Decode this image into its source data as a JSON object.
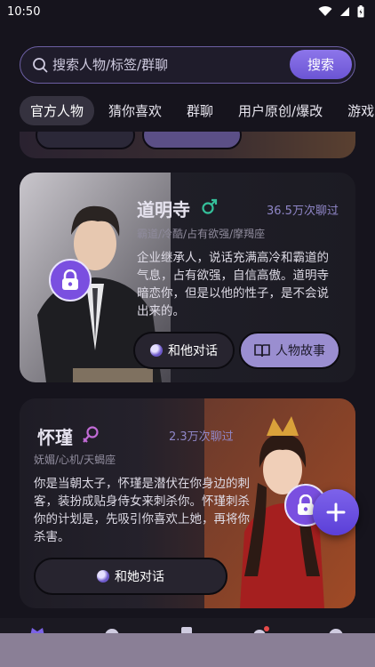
{
  "status": {
    "time": "10:50"
  },
  "search": {
    "placeholder": "搜索人物/标签/群聊",
    "button": "搜索"
  },
  "tabs": [
    {
      "label": "官方人物",
      "active": true
    },
    {
      "label": "猜你喜欢",
      "active": false
    },
    {
      "label": "群聊",
      "active": false
    },
    {
      "label": "用户原创/爆改",
      "active": false
    },
    {
      "label": "游戏人",
      "active": false
    }
  ],
  "cards": [
    {
      "name": "道明寺",
      "gender": "male",
      "chats": "36.5万次聊过",
      "tags": "霸道/冷酷/占有欲强/摩羯座",
      "description": "企业继承人，说话充满高冷和霸道的气息，占有欲强，自信高傲。道明寺暗恋你，但是以他的性子，是不会说出来的。",
      "chat_button": "和他对话",
      "story_button": "人物故事"
    },
    {
      "name": "怀瑾",
      "gender": "female",
      "chats": "2.3万次聊过",
      "tags": "妩媚/心机/天蝎座",
      "description": "你是当朝太子，怀瑾是潜伏在你身边的刺客，装扮成贴身侍女来刺杀你。怀瑾刺杀你的计划是，先吸引你喜欢上她，再将你杀害。",
      "chat_button": "和她对话"
    }
  ],
  "colors": {
    "accent": "#7b63e6",
    "background": "#16141d",
    "chats_text": "#8f86c7"
  }
}
